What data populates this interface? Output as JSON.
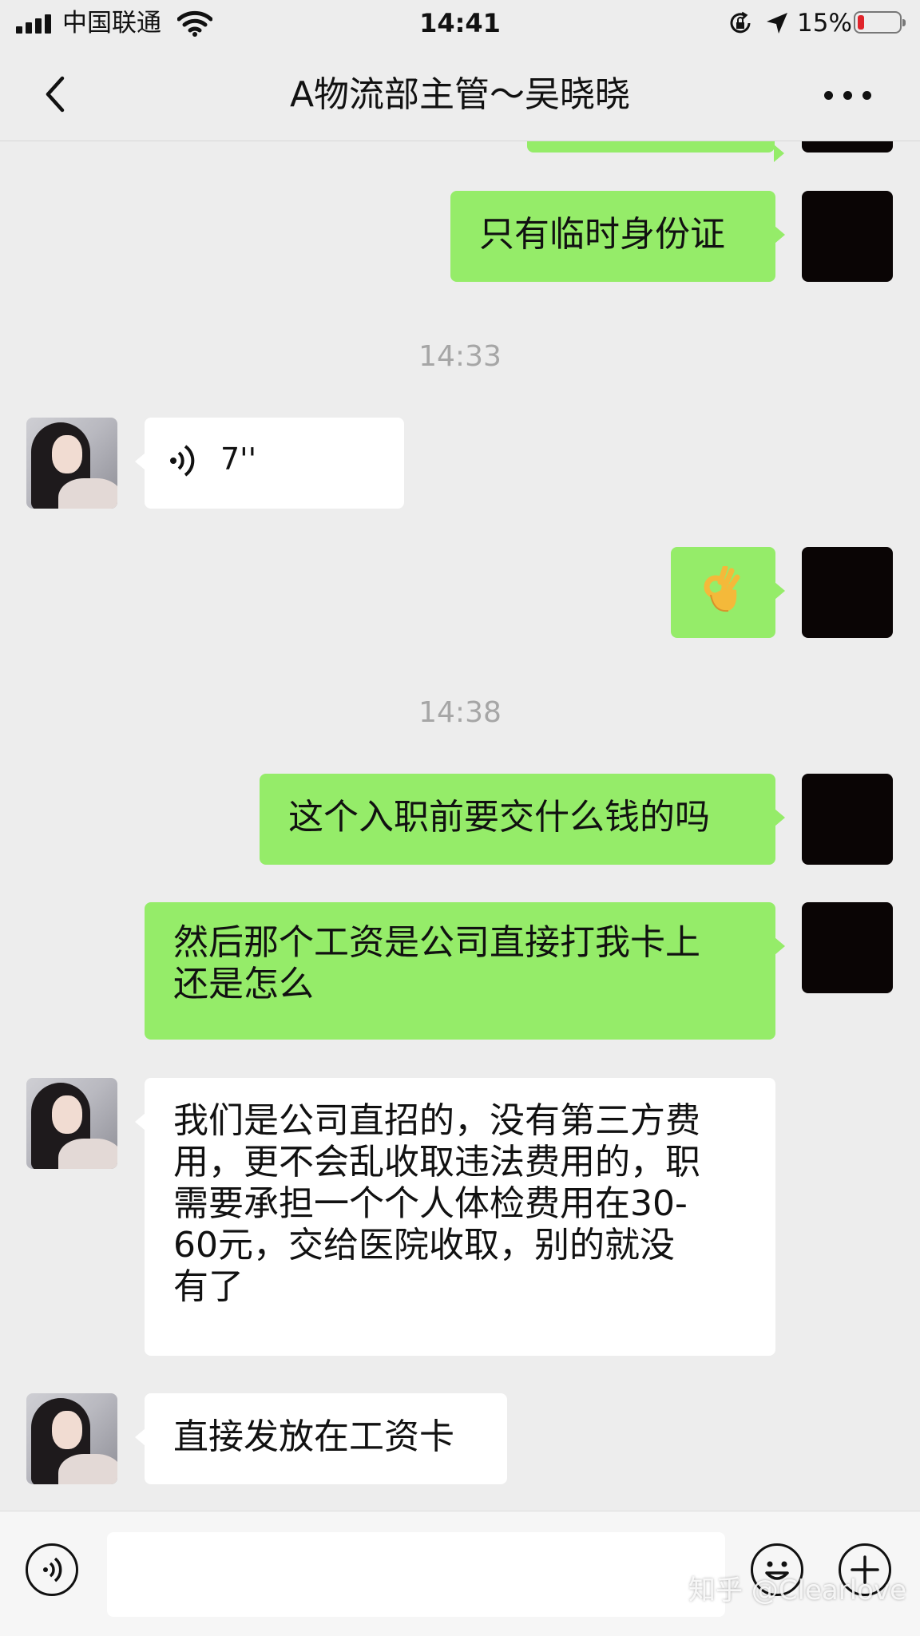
{
  "status_bar": {
    "carrier": "中国联通",
    "time": "14:41",
    "battery_percent_text": "15%",
    "battery_level": 0.15,
    "battery_color": "#e0242b"
  },
  "nav": {
    "title": "A物流部主管～吴晓晓",
    "back_icon": "chevron-left-icon",
    "more_icon": "ellipsis-icon"
  },
  "colors": {
    "background": "#ededed",
    "self_bubble": "#95ec69",
    "other_bubble": "#ffffff",
    "timestamp_text": "#a6a6a6"
  },
  "messages": [
    {
      "sender": "self",
      "type": "text",
      "text": "只有临时身份证"
    },
    {
      "type": "timestamp",
      "text": "14:33"
    },
    {
      "sender": "other",
      "type": "voice",
      "duration": "7''",
      "icon": "voice-wave-icon"
    },
    {
      "sender": "self",
      "type": "emoji",
      "emoji": "ok-hand-emoji"
    },
    {
      "type": "timestamp",
      "text": "14:38"
    },
    {
      "sender": "self",
      "type": "text",
      "text": "这个入职前要交什么钱的吗"
    },
    {
      "sender": "self",
      "type": "text",
      "text": "然后那个工资是公司直接打我卡上\n还是怎么"
    },
    {
      "sender": "other",
      "type": "text",
      "text": "我们是公司直招的，没有第三方费\n用，更不会乱收取违法费用的，职\n需要承担一个个人体检费用在30-\n60元，交给医院收取，别的就没\n有了"
    },
    {
      "sender": "other",
      "type": "text",
      "text": "直接发放在工资卡"
    }
  ],
  "input_bar": {
    "voice_icon": "voice-toggle-icon",
    "emoji_icon": "smiley-icon",
    "plus_icon": "plus-icon",
    "input_value": ""
  },
  "watermark": "知乎 @Clearlove"
}
